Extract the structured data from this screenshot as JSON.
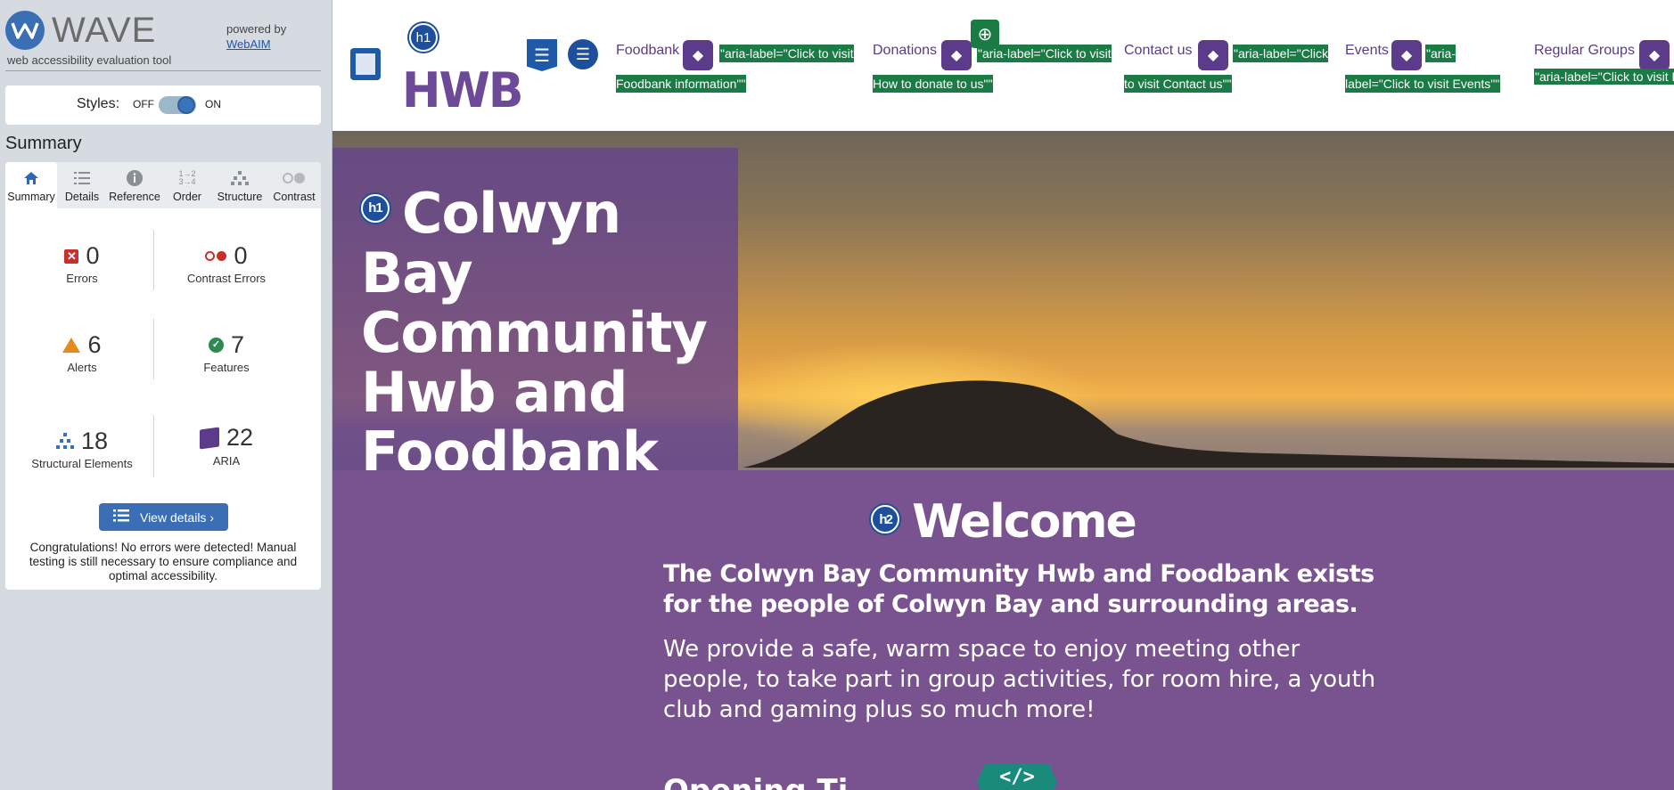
{
  "wave": {
    "logo_text": "WAVE",
    "tagline": "web accessibility evaluation tool",
    "powered_by": "powered by",
    "webaim_link": "WebAIM",
    "styles_label": "Styles:",
    "styles_off": "OFF",
    "styles_on": "ON",
    "summary_title": "Summary",
    "tabs": [
      {
        "label": "Summary",
        "icon": "home-icon"
      },
      {
        "label": "Details",
        "icon": "list-icon"
      },
      {
        "label": "Reference",
        "icon": "info-icon"
      },
      {
        "label": "Order",
        "icon": "order-icon"
      },
      {
        "label": "Structure",
        "icon": "structure-icon"
      },
      {
        "label": "Contrast",
        "icon": "contrast-icon"
      }
    ],
    "stats": {
      "errors": {
        "count": "0",
        "label": "Errors"
      },
      "contrast_errors": {
        "count": "0",
        "label": "Contrast Errors"
      },
      "alerts": {
        "count": "6",
        "label": "Alerts"
      },
      "features": {
        "count": "7",
        "label": "Features"
      },
      "structural": {
        "count": "18",
        "label": "Structural Elements"
      },
      "aria": {
        "count": "22",
        "label": "ARIA"
      }
    },
    "view_details": "View details ›",
    "congrats": "Congratulations! No errors were detected! Manual testing is still necessary to ensure compliance and optimal accessibility."
  },
  "page": {
    "badge_h1": "h1",
    "logo_text": "HWB",
    "nav": [
      {
        "label": "Foodbank",
        "aria": "\"aria-label=\"Click to visit Foodbank information\"\""
      },
      {
        "label": "Donations",
        "aria": "\"aria-label=\"Click to visit How to donate to us\"\""
      },
      {
        "label": "Contact us",
        "aria": "\"aria-label=\"Click to visit Contact us\"\""
      },
      {
        "label": "Events",
        "aria": "\"aria-label=\"Click to visit Events\"\""
      },
      {
        "label": "Regular Groups",
        "aria": "\"aria-label=\"Click to visit Regular Events\"\""
      }
    ],
    "hero_title": "Colwyn Bay Community Hwb and Foodbank",
    "badge_h2": "h2",
    "welcome_title": "Welcome",
    "lead": "The Colwyn Bay Community Hwb and Foodbank exists for the people of Colwyn Bay and surrounding areas.",
    "body": "We provide a safe, warm space to enjoy meeting other people, to take part in group activities, for room hire, a youth club and gaming plus so much more!",
    "code_icon": "</>",
    "next_heading": "Opening Ti"
  },
  "colors": {
    "wave_blue": "#3a6fb5",
    "brand_purple": "#5b3b8a",
    "welcome_bg": "#785390",
    "aria_green": "#1a7b45"
  }
}
